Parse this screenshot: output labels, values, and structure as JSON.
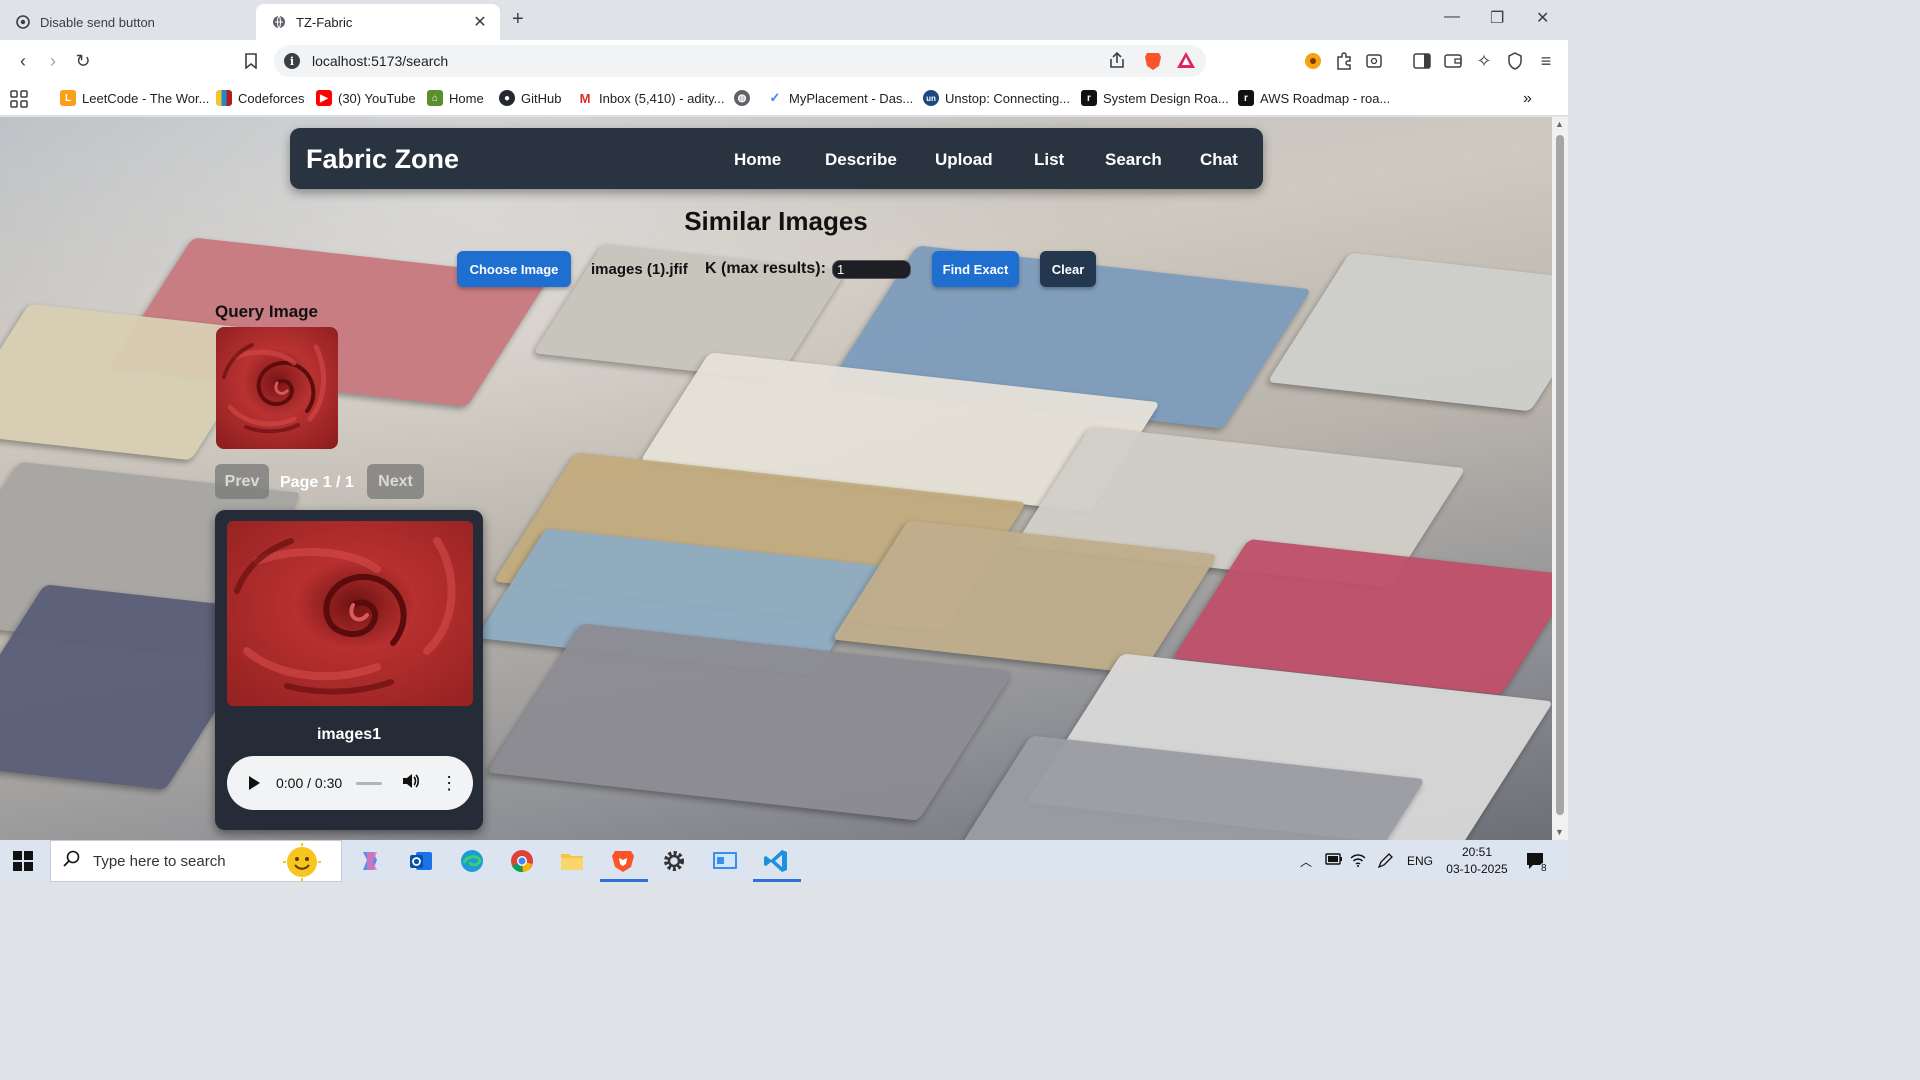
{
  "browser": {
    "tabs": [
      {
        "title": "Disable send button",
        "active": false
      },
      {
        "title": "TZ-Fabric",
        "active": true
      }
    ],
    "url": "localhost:5173/search",
    "bookmarks": [
      {
        "label": "LeetCode - The Wor...",
        "icon": "leetcode-icon",
        "color": "#f89f1b"
      },
      {
        "label": "Codeforces",
        "icon": "codeforces-icon",
        "color": "#1f8acb"
      },
      {
        "label": "(30) YouTube",
        "icon": "youtube-icon",
        "color": "#ff0000"
      },
      {
        "label": "Home",
        "icon": "home-icon",
        "color": "#5a8f2d"
      },
      {
        "label": "GitHub",
        "icon": "github-icon",
        "color": "#24292f"
      },
      {
        "label": "Inbox (5,410) - adity...",
        "icon": "gmail-icon",
        "color": "#d93025"
      },
      {
        "label": "",
        "icon": "globe-icon",
        "color": "#5f6368"
      },
      {
        "label": "MyPlacement - Das...",
        "icon": "myplacement-icon",
        "color": "#3b82f6"
      },
      {
        "label": "Unstop: Connecting...",
        "icon": "unstop-icon",
        "color": "#1c4980"
      },
      {
        "label": "System Design Roa...",
        "icon": "roadmap-icon",
        "color": "#111111"
      },
      {
        "label": "AWS Roadmap - roa...",
        "icon": "roadmap-icon",
        "color": "#111111"
      }
    ]
  },
  "app": {
    "brand": "Fabric Zone",
    "nav": [
      "Home",
      "Describe",
      "Upload",
      "List",
      "Search",
      "Chat"
    ],
    "page_title": "Similar Images",
    "controls": {
      "choose_label": "Choose Image",
      "file_name": "images (1).jfif",
      "k_label": "K (max results):",
      "k_value": "1",
      "find_label": "Find Exact",
      "clear_label": "Clear"
    },
    "query_label": "Query Image",
    "pagination": {
      "prev": "Prev",
      "info": "Page 1 / 1",
      "next": "Next"
    },
    "result": {
      "name": "images1",
      "audio_time": "0:00 / 0:30"
    },
    "colors": {
      "accent_blue": "#1e6fd0",
      "navbar": "#2a3340",
      "fabric_red": "#a32828"
    }
  },
  "taskbar": {
    "search_placeholder": "Type here to search",
    "language": "ENG",
    "time": "20:51",
    "date": "03-10-2025",
    "notification_count": "8"
  }
}
